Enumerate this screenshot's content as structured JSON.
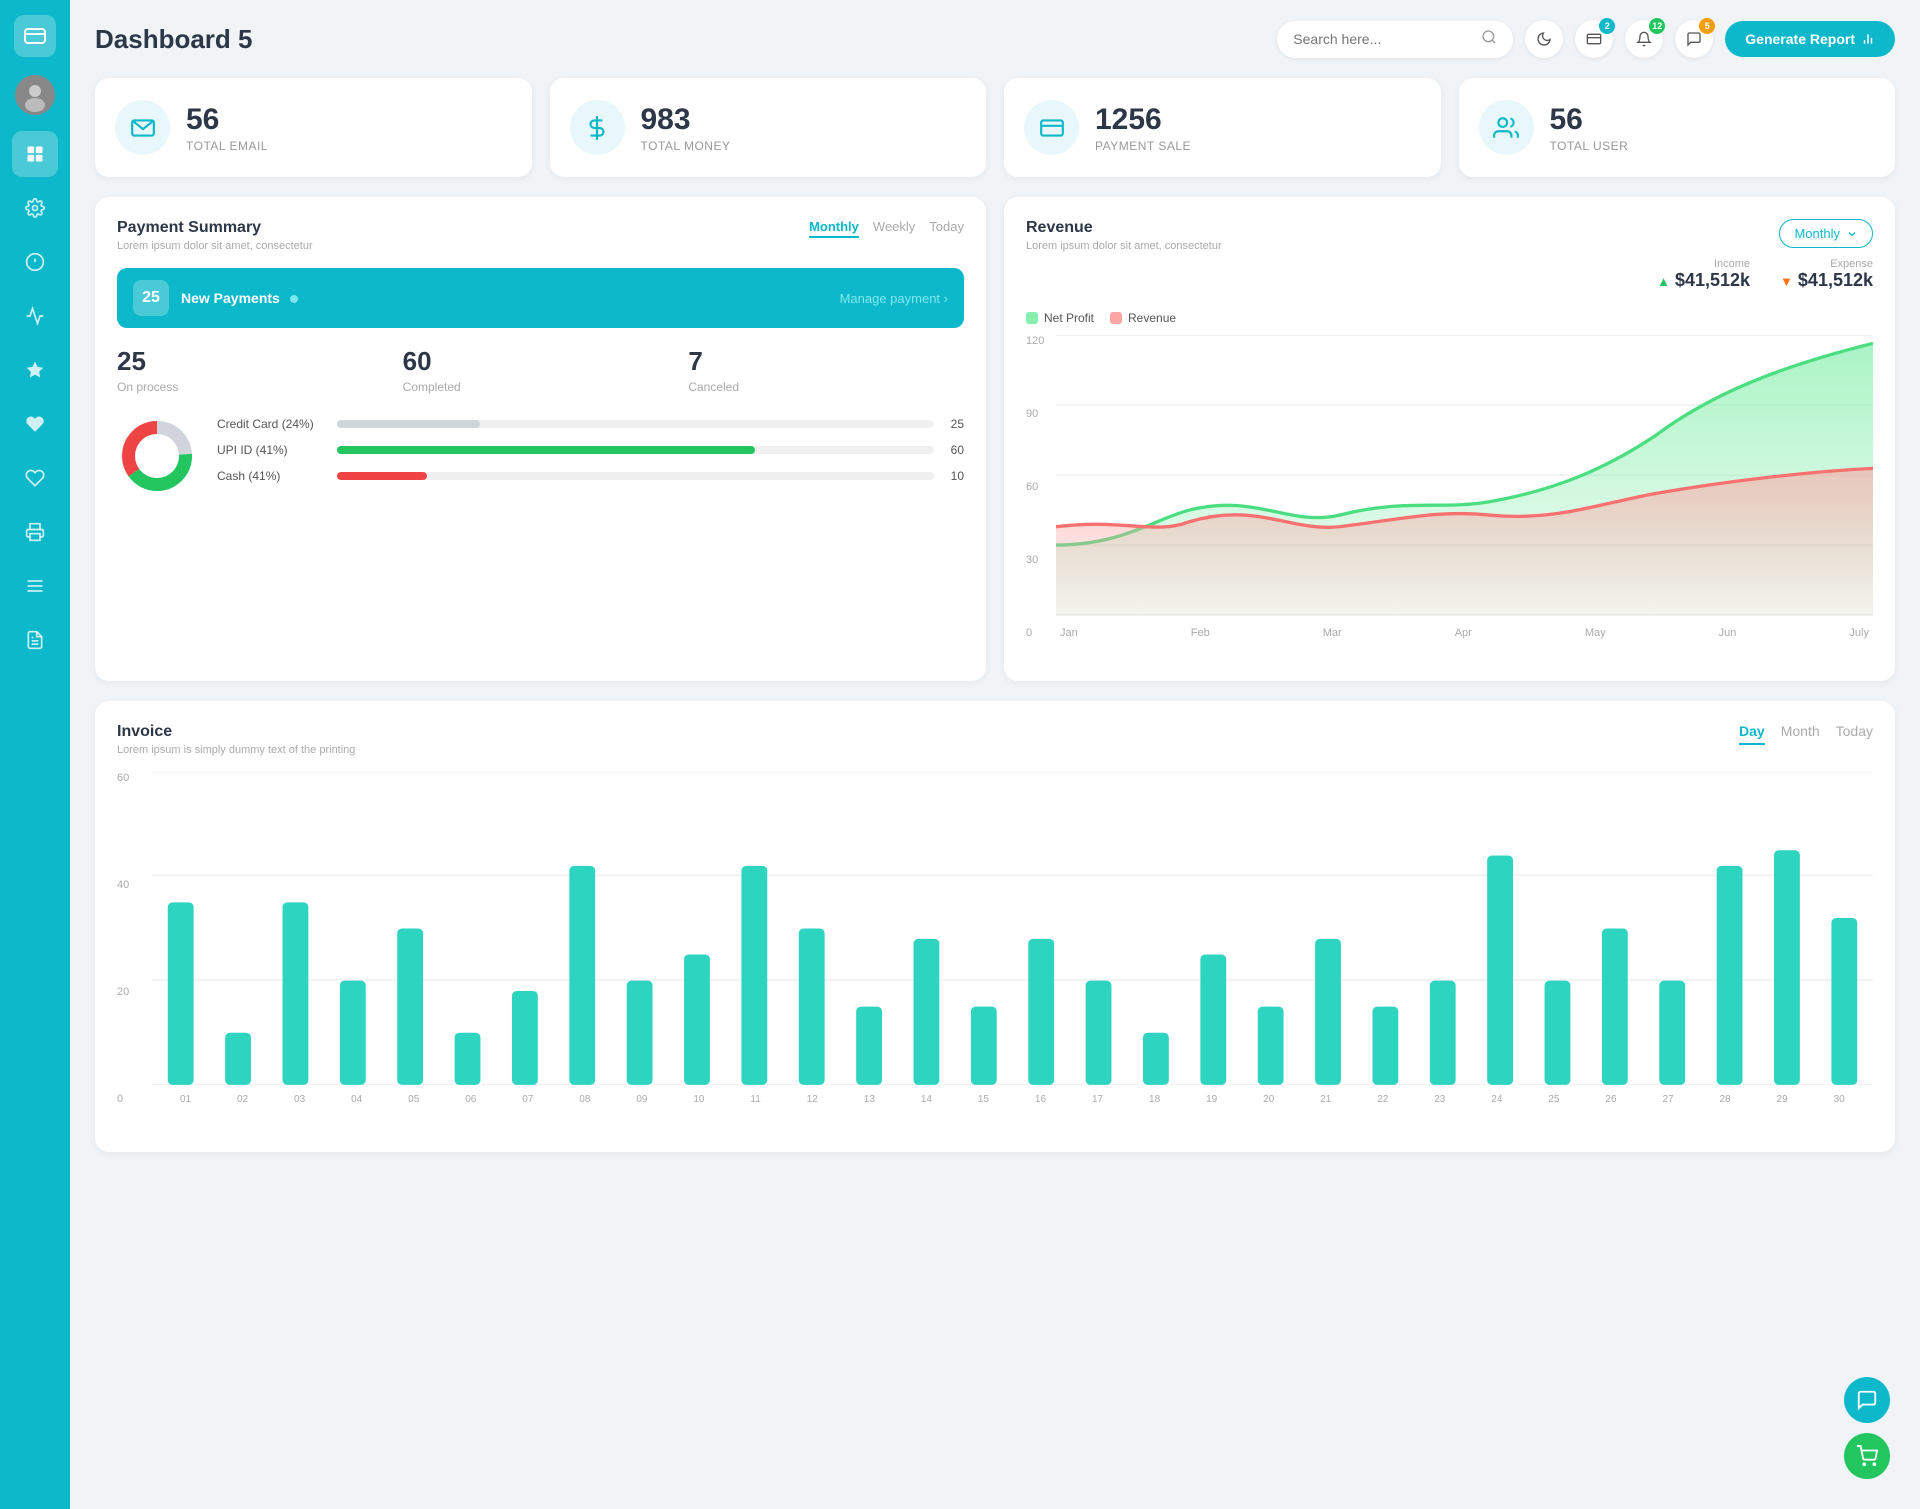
{
  "app": {
    "title": "Dashboard 5"
  },
  "header": {
    "search_placeholder": "Search here...",
    "generate_btn": "Generate Report",
    "badges": {
      "wallet": "2",
      "bell": "12",
      "chat": "5"
    }
  },
  "stats": [
    {
      "id": "email",
      "number": "56",
      "label": "TOTAL EMAIL",
      "icon": "📋"
    },
    {
      "id": "money",
      "number": "983",
      "label": "TOTAL MONEY",
      "icon": "$"
    },
    {
      "id": "payment",
      "number": "1256",
      "label": "PAYMENT SALE",
      "icon": "💳"
    },
    {
      "id": "user",
      "number": "56",
      "label": "TOTAL USER",
      "icon": "👤"
    }
  ],
  "payment_summary": {
    "title": "Payment Summary",
    "subtitle": "Lorem ipsum dolor sit amet, consectetur",
    "tabs": [
      "Monthly",
      "Weekly",
      "Today"
    ],
    "active_tab": "Monthly",
    "new_payments_count": "25",
    "new_payments_label": "New Payments",
    "manage_link": "Manage payment",
    "on_process": "25",
    "on_process_label": "On process",
    "completed": "60",
    "completed_label": "Completed",
    "canceled": "7",
    "canceled_label": "Canceled",
    "methods": [
      {
        "label": "Credit Card (24%)",
        "percent": 24,
        "color": "#aaa",
        "value": "25"
      },
      {
        "label": "UPI ID (41%)",
        "percent": 70,
        "color": "#22c55e",
        "value": "60"
      },
      {
        "label": "Cash (41%)",
        "percent": 15,
        "color": "#ef4444",
        "value": "10"
      }
    ]
  },
  "revenue": {
    "title": "Revenue",
    "subtitle": "Lorem ipsum dolor sit amet, consectetur",
    "filter": "Monthly",
    "income_label": "Income",
    "income_value": "$41,512k",
    "expense_label": "Expense",
    "expense_value": "$41,512k",
    "legend": [
      {
        "label": "Net Profit",
        "color": "#86efac"
      },
      {
        "label": "Revenue",
        "color": "#fca5a5"
      }
    ],
    "x_labels": [
      "Jan",
      "Feb",
      "Mar",
      "Apr",
      "May",
      "Jun",
      "July"
    ],
    "y_labels": [
      "120",
      "90",
      "60",
      "30",
      "0"
    ]
  },
  "invoice": {
    "title": "Invoice",
    "subtitle": "Lorem ipsum is simply dummy text of the printing",
    "tabs": [
      "Day",
      "Month",
      "Today"
    ],
    "active_tab": "Day",
    "y_labels": [
      "60",
      "40",
      "20",
      "0"
    ],
    "x_labels": [
      "01",
      "02",
      "03",
      "04",
      "05",
      "06",
      "07",
      "08",
      "09",
      "10",
      "11",
      "12",
      "13",
      "14",
      "15",
      "16",
      "17",
      "18",
      "19",
      "20",
      "21",
      "22",
      "23",
      "24",
      "25",
      "26",
      "27",
      "28",
      "29",
      "30"
    ],
    "bar_color": "#2dd4bf"
  },
  "sidebar": {
    "items": [
      {
        "id": "wallet",
        "icon": "💼",
        "active": true,
        "label": "wallet"
      },
      {
        "id": "settings",
        "icon": "⚙",
        "active": false,
        "label": "settings"
      },
      {
        "id": "info",
        "icon": "ℹ",
        "active": false,
        "label": "info"
      },
      {
        "id": "chart",
        "icon": "📊",
        "active": false,
        "label": "chart"
      },
      {
        "id": "star",
        "icon": "★",
        "active": false,
        "label": "star"
      },
      {
        "id": "heart",
        "icon": "♥",
        "active": false,
        "label": "heart"
      },
      {
        "id": "heart2",
        "icon": "♥",
        "active": false,
        "label": "heart2"
      },
      {
        "id": "print",
        "icon": "🖨",
        "active": false,
        "label": "print"
      },
      {
        "id": "list",
        "icon": "☰",
        "active": false,
        "label": "list"
      },
      {
        "id": "doc",
        "icon": "📄",
        "active": false,
        "label": "doc"
      }
    ]
  }
}
